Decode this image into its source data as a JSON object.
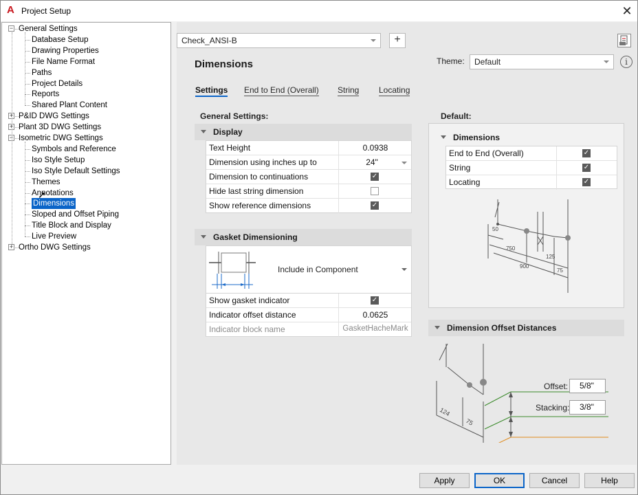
{
  "window": {
    "title": "Project Setup",
    "app_icon": "autocad-a-icon",
    "close_icon": "close-icon"
  },
  "tree": {
    "items": [
      {
        "label": "General Settings",
        "level": 0,
        "expander": "minus"
      },
      {
        "label": "Database Setup",
        "level": 1
      },
      {
        "label": "Drawing Properties",
        "level": 1
      },
      {
        "label": "File Name Format",
        "level": 1
      },
      {
        "label": "Paths",
        "level": 1
      },
      {
        "label": "Project Details",
        "level": 1
      },
      {
        "label": "Reports",
        "level": 1
      },
      {
        "label": "Shared Plant Content",
        "level": 1
      },
      {
        "label": "P&ID DWG Settings",
        "level": 0,
        "expander": "plus"
      },
      {
        "label": "Plant 3D DWG Settings",
        "level": 0,
        "expander": "plus"
      },
      {
        "label": "Isometric DWG Settings",
        "level": 0,
        "expander": "minus"
      },
      {
        "label": "Symbols and Reference",
        "level": 1
      },
      {
        "label": "Iso Style Setup",
        "level": 1
      },
      {
        "label": "Iso Style Default Settings",
        "level": 1
      },
      {
        "label": "Themes",
        "level": 1
      },
      {
        "label": "Annotations",
        "level": 1
      },
      {
        "label": "Dimensions",
        "level": 1,
        "selected": true
      },
      {
        "label": "Sloped and Offset Piping",
        "level": 1
      },
      {
        "label": "Title Block and Display",
        "level": 1
      },
      {
        "label": "Live Preview",
        "level": 1
      },
      {
        "label": "Ortho DWG Settings",
        "level": 0,
        "expander": "plus"
      }
    ]
  },
  "style_combo": {
    "value": "Check_ANSI-B",
    "add_icon": "plus-icon"
  },
  "report_icon": "report-icon",
  "page_title": "Dimensions",
  "theme": {
    "label": "Theme:",
    "value": "Default",
    "info_icon": "info-icon"
  },
  "tabs": [
    {
      "label": "Settings",
      "active": true
    },
    {
      "label": "End to End (Overall)"
    },
    {
      "label": "String"
    },
    {
      "label": "Locating"
    }
  ],
  "general_settings_heading": "General Settings:",
  "display_section": {
    "title": "Display",
    "rows": [
      {
        "name": "Text Height",
        "value": "0.0938"
      },
      {
        "name": "Dimension using inches up to",
        "value": "24\"",
        "dropdown": true
      },
      {
        "name": "Dimension to continuations",
        "checked": true
      },
      {
        "name": "Hide last string dimension",
        "checked": false
      },
      {
        "name": "Show reference dimensions",
        "checked": true
      }
    ]
  },
  "gasket_section": {
    "title": "Gasket Dimensioning",
    "component_option": "Include in Component",
    "rows": [
      {
        "name": "Show gasket indicator",
        "checked": true
      },
      {
        "name": "Indicator offset distance",
        "value": "0.0625"
      },
      {
        "name": "Indicator block name",
        "value": "GasketHacheMark",
        "disabled": true
      }
    ]
  },
  "default_panel": {
    "heading": "Default:",
    "section_title": "Dimensions",
    "rows": [
      {
        "name": "End to End (Overall)",
        "checked": true
      },
      {
        "name": "String",
        "checked": true
      },
      {
        "name": "Locating",
        "checked": true
      }
    ],
    "diagram_labels": [
      "50",
      "750",
      "900",
      "125",
      "75"
    ]
  },
  "offset_panel": {
    "title": "Dimension Offset Distances",
    "offset_label": "Offset:",
    "offset_value": "5/8\"",
    "stacking_label": "Stacking:",
    "stacking_value": "3/8\"",
    "diagram_labels": [
      "124",
      "75"
    ],
    "colors": {
      "offset_line": "#3a8a2a",
      "stacking_line": "#e08a1a"
    }
  },
  "buttons": {
    "apply": "Apply",
    "ok": "OK",
    "cancel": "Cancel",
    "help": "Help"
  }
}
